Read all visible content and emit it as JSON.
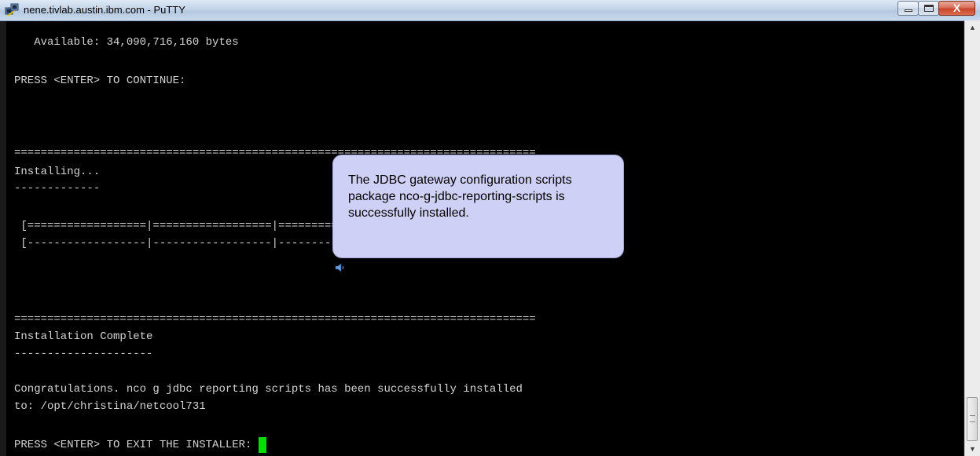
{
  "window": {
    "title": "nene.tivlab.austin.ibm.com - PuTTY",
    "close_label": "X"
  },
  "terminal": {
    "lines": [
      "   Available: 34,090,716,160 bytes",
      "PRESS <ENTER> TO CONTINUE:",
      "===============================================================================",
      "Installing...",
      "-------------",
      " [==================|==================|==================|==================]",
      " [------------------|------------------|------------------|------------------]",
      "===============================================================================",
      "Installation Complete",
      "---------------------",
      "Congratulations. nco g jdbc reporting scripts has been successfully installed",
      "to: /opt/christina/netcool731",
      "PRESS <ENTER> TO EXIT THE INSTALLER: "
    ]
  },
  "callout": {
    "text": "The JDBC gateway configuration scripts package nco-g-jdbc-reporting-scripts is successfully installed."
  },
  "icons": {
    "app": "putty-icon",
    "audio": "speaker-icon"
  },
  "colors": {
    "terminal_bg": "#000000",
    "terminal_fg": "#d4d4d4",
    "cursor": "#00e000",
    "callout_bg": "#cfd0f5"
  }
}
